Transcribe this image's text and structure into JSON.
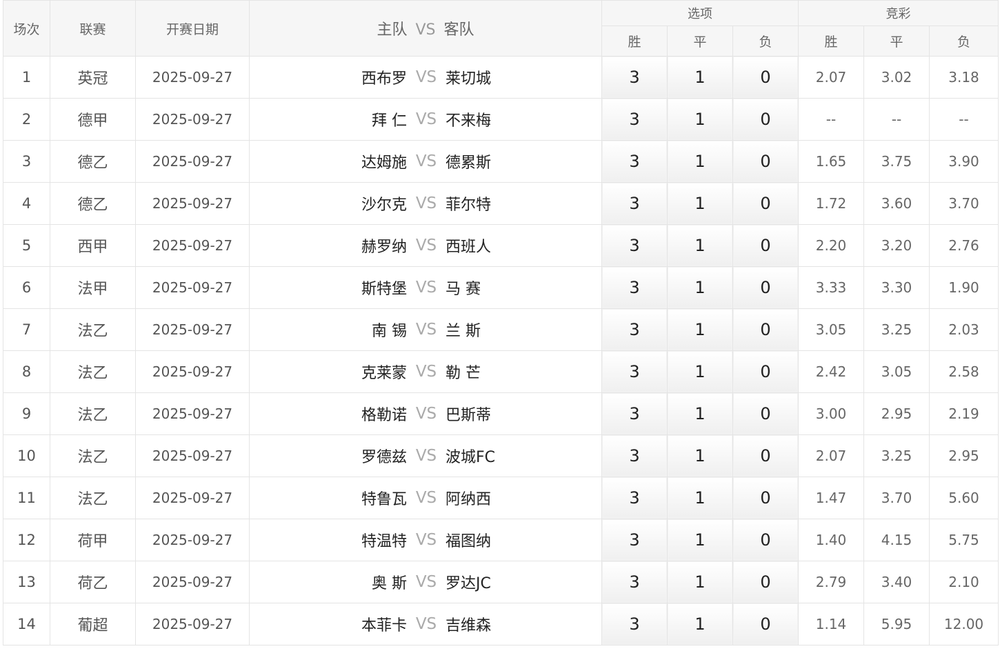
{
  "headers": {
    "index": "场次",
    "league": "联赛",
    "date": "开赛日期",
    "home": "主队",
    "vs": "VS",
    "away": "客队",
    "options_group": "选项",
    "odds_group": "竞彩",
    "win": "胜",
    "draw": "平",
    "loss": "负"
  },
  "rows": [
    {
      "index": "1",
      "league": "英冠",
      "date": "2025-09-27",
      "home": "西布罗",
      "vs": "VS",
      "away": "莱切城",
      "opt_win": "3",
      "opt_draw": "1",
      "opt_loss": "0",
      "odds_win": "2.07",
      "odds_draw": "3.02",
      "odds_loss": "3.18"
    },
    {
      "index": "2",
      "league": "德甲",
      "date": "2025-09-27",
      "home": "拜 仁",
      "vs": "VS",
      "away": "不来梅",
      "opt_win": "3",
      "opt_draw": "1",
      "opt_loss": "0",
      "odds_win": "--",
      "odds_draw": "--",
      "odds_loss": "--"
    },
    {
      "index": "3",
      "league": "德乙",
      "date": "2025-09-27",
      "home": "达姆施",
      "vs": "VS",
      "away": "德累斯",
      "opt_win": "3",
      "opt_draw": "1",
      "opt_loss": "0",
      "odds_win": "1.65",
      "odds_draw": "3.75",
      "odds_loss": "3.90"
    },
    {
      "index": "4",
      "league": "德乙",
      "date": "2025-09-27",
      "home": "沙尔克",
      "vs": "VS",
      "away": "菲尔特",
      "opt_win": "3",
      "opt_draw": "1",
      "opt_loss": "0",
      "odds_win": "1.72",
      "odds_draw": "3.60",
      "odds_loss": "3.70"
    },
    {
      "index": "5",
      "league": "西甲",
      "date": "2025-09-27",
      "home": "赫罗纳",
      "vs": "VS",
      "away": "西班人",
      "opt_win": "3",
      "opt_draw": "1",
      "opt_loss": "0",
      "odds_win": "2.20",
      "odds_draw": "3.20",
      "odds_loss": "2.76"
    },
    {
      "index": "6",
      "league": "法甲",
      "date": "2025-09-27",
      "home": "斯特堡",
      "vs": "VS",
      "away": "马 赛",
      "opt_win": "3",
      "opt_draw": "1",
      "opt_loss": "0",
      "odds_win": "3.33",
      "odds_draw": "3.30",
      "odds_loss": "1.90"
    },
    {
      "index": "7",
      "league": "法乙",
      "date": "2025-09-27",
      "home": "南 锡",
      "vs": "VS",
      "away": "兰 斯",
      "opt_win": "3",
      "opt_draw": "1",
      "opt_loss": "0",
      "odds_win": "3.05",
      "odds_draw": "3.25",
      "odds_loss": "2.03"
    },
    {
      "index": "8",
      "league": "法乙",
      "date": "2025-09-27",
      "home": "克莱蒙",
      "vs": "VS",
      "away": "勒 芒",
      "opt_win": "3",
      "opt_draw": "1",
      "opt_loss": "0",
      "odds_win": "2.42",
      "odds_draw": "3.05",
      "odds_loss": "2.58"
    },
    {
      "index": "9",
      "league": "法乙",
      "date": "2025-09-27",
      "home": "格勒诺",
      "vs": "VS",
      "away": "巴斯蒂",
      "opt_win": "3",
      "opt_draw": "1",
      "opt_loss": "0",
      "odds_win": "3.00",
      "odds_draw": "2.95",
      "odds_loss": "2.19"
    },
    {
      "index": "10",
      "league": "法乙",
      "date": "2025-09-27",
      "home": "罗德兹",
      "vs": "VS",
      "away": "波城FC",
      "opt_win": "3",
      "opt_draw": "1",
      "opt_loss": "0",
      "odds_win": "2.07",
      "odds_draw": "3.25",
      "odds_loss": "2.95"
    },
    {
      "index": "11",
      "league": "法乙",
      "date": "2025-09-27",
      "home": "特鲁瓦",
      "vs": "VS",
      "away": "阿纳西",
      "opt_win": "3",
      "opt_draw": "1",
      "opt_loss": "0",
      "odds_win": "1.47",
      "odds_draw": "3.70",
      "odds_loss": "5.60"
    },
    {
      "index": "12",
      "league": "荷甲",
      "date": "2025-09-27",
      "home": "特温特",
      "vs": "VS",
      "away": "福图纳",
      "opt_win": "3",
      "opt_draw": "1",
      "opt_loss": "0",
      "odds_win": "1.40",
      "odds_draw": "4.15",
      "odds_loss": "5.75"
    },
    {
      "index": "13",
      "league": "荷乙",
      "date": "2025-09-27",
      "home": "奥 斯",
      "vs": "VS",
      "away": "罗达JC",
      "opt_win": "3",
      "opt_draw": "1",
      "opt_loss": "0",
      "odds_win": "2.79",
      "odds_draw": "3.40",
      "odds_loss": "2.10"
    },
    {
      "index": "14",
      "league": "葡超",
      "date": "2025-09-27",
      "home": "本菲卡",
      "vs": "VS",
      "away": "吉维森",
      "opt_win": "3",
      "opt_draw": "1",
      "opt_loss": "0",
      "odds_win": "1.14",
      "odds_draw": "5.95",
      "odds_loss": "12.00"
    }
  ]
}
